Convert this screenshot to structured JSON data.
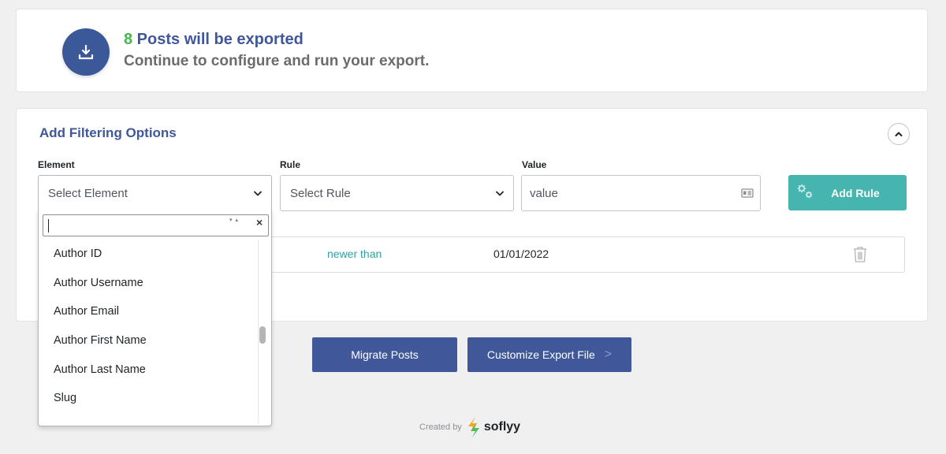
{
  "summary": {
    "count": "8",
    "headline_rest": " Posts will be exported",
    "subtitle": "Continue to configure and run your export."
  },
  "filter": {
    "title": "Add Filtering Options",
    "element_label": "Element",
    "rule_label": "Rule",
    "value_label": "Value",
    "element_placeholder": "Select Element",
    "rule_placeholder": "Select Rule",
    "value_placeholder": "value",
    "add_rule_label": "Add Rule",
    "existing_rule": {
      "condition": "newer than",
      "value": "01/01/2022"
    }
  },
  "dropdown": {
    "search_value": "",
    "items": [
      "Author ID",
      "Author Username",
      "Author Email",
      "Author First Name",
      "Author Last Name",
      "Slug"
    ],
    "scroll_position": 0.5
  },
  "actions": {
    "migrate_label": "Migrate Posts",
    "customize_label": "Customize Export File",
    "customize_arrow": ">"
  },
  "footer": {
    "created_by": "Created by",
    "brand": "soflyy"
  },
  "colors": {
    "primary": "#40589a",
    "count_green": "#46b450",
    "teal": "#46b5b0",
    "rule_text": "#2ea2a2"
  },
  "icons": {
    "export": "download-tray-icon",
    "collapse": "chevron-up-icon",
    "select": "chevron-down-icon",
    "value_field": "id-card-icon",
    "add_rule": "gears-icon",
    "delete": "trash-icon",
    "brand": "soflyy-logo"
  }
}
